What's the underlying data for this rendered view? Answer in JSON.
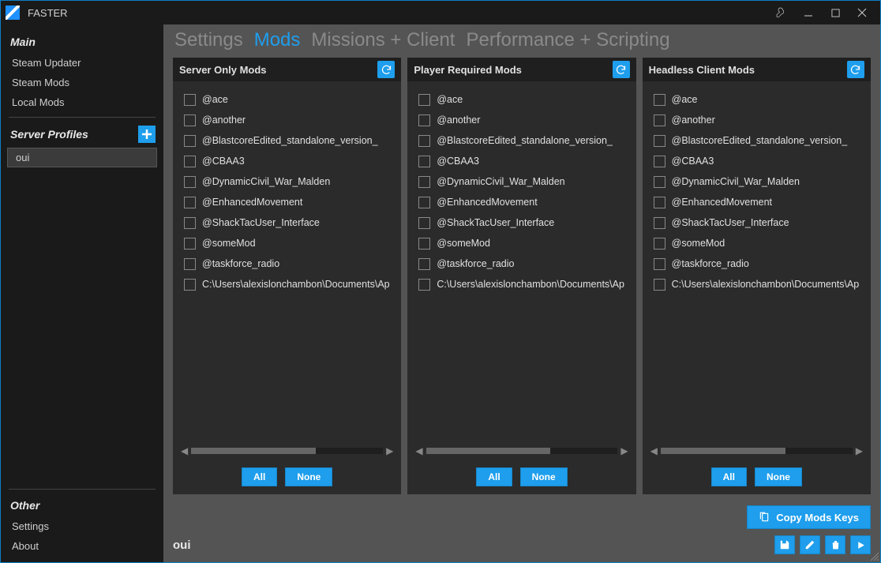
{
  "window": {
    "title": "FASTER"
  },
  "sidebar": {
    "main_heading": "Main",
    "main_items": [
      "Steam Updater",
      "Steam Mods",
      "Local Mods"
    ],
    "profiles_heading": "Server Profiles",
    "profiles": [
      "oui"
    ],
    "other_heading": "Other",
    "other_items": [
      "Settings",
      "About"
    ]
  },
  "tabs": [
    "Settings",
    "Mods",
    "Missions + Client",
    "Performance + Scripting"
  ],
  "active_tab": 1,
  "columns": [
    {
      "title": "Server Only Mods"
    },
    {
      "title": "Player Required Mods"
    },
    {
      "title": "Headless Client Mods"
    }
  ],
  "mods": [
    "@ace",
    "@another",
    "@BlastcoreEdited_standalone_version_",
    "@CBAA3",
    "@DynamicCivil_War_Malden",
    "@EnhancedMovement",
    "@ShackTacUser_Interface",
    "@someMod",
    "@taskforce_radio",
    "C:\\Users\\alexislonchambon\\Documents\\Ap"
  ],
  "buttons": {
    "all": "All",
    "none": "None",
    "copy_keys": "Copy Mods Keys"
  },
  "footer": {
    "profile_name": "oui"
  }
}
